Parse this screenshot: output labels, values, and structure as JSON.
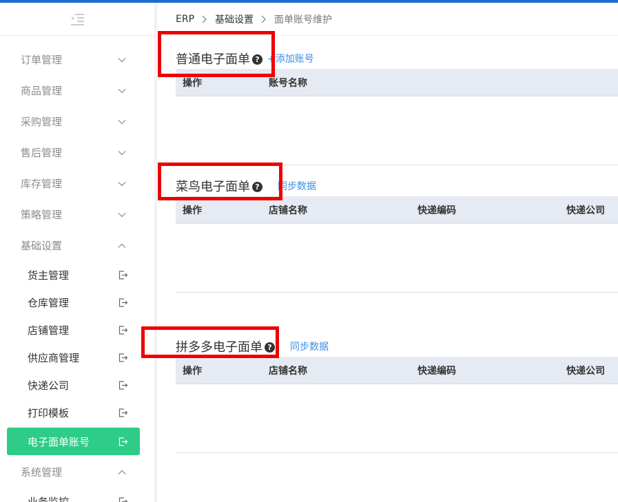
{
  "sidebar": {
    "groups_top": [
      {
        "label": "订单管理"
      },
      {
        "label": "商品管理"
      },
      {
        "label": "采购管理"
      },
      {
        "label": "售后管理"
      },
      {
        "label": "库存管理"
      },
      {
        "label": "策略管理"
      }
    ],
    "open_group": {
      "label": "基础设置"
    },
    "subitems": [
      {
        "label": "货主管理"
      },
      {
        "label": "仓库管理"
      },
      {
        "label": "店铺管理"
      },
      {
        "label": "供应商管理"
      },
      {
        "label": "快递公司"
      },
      {
        "label": "打印模板"
      }
    ],
    "active_item": {
      "label": "电子面单账号"
    },
    "system_group": {
      "label": "系统管理"
    },
    "partial_item": {
      "label": "业务监控"
    }
  },
  "breadcrumb": {
    "root": "ERP",
    "middle": "基础设置",
    "current": "面单账号维护"
  },
  "sections": {
    "normal": {
      "title": "普通电子面单",
      "link": "+添加账号",
      "columns": [
        "操作",
        "账号名称"
      ]
    },
    "cainiao": {
      "title": "菜鸟电子面单",
      "link": "同步数据",
      "columns": [
        "操作",
        "店铺名称",
        "快递编码",
        "快递公司"
      ]
    },
    "pdd": {
      "title": "拼多多电子面单",
      "link": "同步数据",
      "columns": [
        "操作",
        "店铺名称",
        "快递编码",
        "快递公司"
      ]
    }
  },
  "icons": {
    "help": "?"
  },
  "colors": {
    "accent": "#2ecc87",
    "link": "#3a8ee6",
    "topbar": "#1f6ad1",
    "highlight": "#ee0000"
  }
}
